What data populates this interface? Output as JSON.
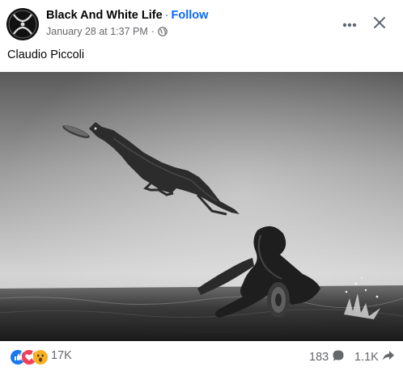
{
  "header": {
    "page_name": "Black And White Life",
    "separator": "·",
    "follow_label": "Follow",
    "timestamp": "January 28 at 1:37 PM",
    "timestamp_sep": "·",
    "privacy_icon": "globe-icon",
    "more_icon": "more-options-icon",
    "close_icon": "close-icon"
  },
  "post": {
    "caption": "Claudio Piccoli",
    "photo_icon": "photo"
  },
  "footer": {
    "reaction_icons": [
      "like-icon",
      "love-icon",
      "wow-icon"
    ],
    "reaction_count": "17K",
    "comment_count": "183",
    "comment_icon": "comment-icon",
    "share_count": "1.1K",
    "share_icon": "share-icon"
  },
  "colors": {
    "accent": "#0866ff",
    "secondary_text": "#65676b",
    "like": "#1877f2",
    "love": "#f33e58",
    "wow": "#f7b125"
  }
}
